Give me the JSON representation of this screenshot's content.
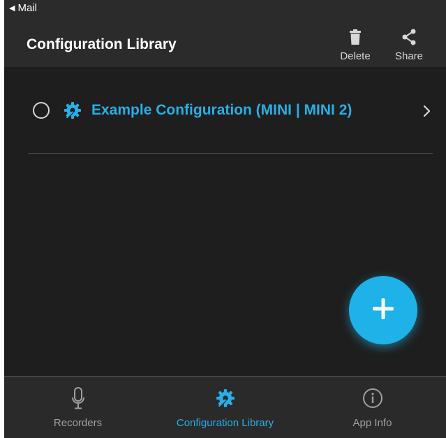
{
  "status_bar": {
    "back_label": "Mail"
  },
  "header": {
    "title": "Configuration Library",
    "actions": [
      {
        "label": "Delete",
        "icon": "trash-icon"
      },
      {
        "label": "Share",
        "icon": "share-icon"
      }
    ]
  },
  "library": {
    "items": [
      {
        "label": "Example Configuration (MINI | MINI 2)",
        "icon": "gear-wrench-icon",
        "selected": false
      }
    ]
  },
  "fab": {
    "icon": "plus-icon"
  },
  "tabs": [
    {
      "label": "Recorders",
      "icon": "microphone-icon",
      "active": false
    },
    {
      "label": "Configuration Library",
      "icon": "gear-wrench-icon",
      "active": true
    },
    {
      "label": "App Info",
      "icon": "info-icon",
      "active": false
    }
  ],
  "colors": {
    "accent": "#29aee6",
    "fab": "#1fb2e8",
    "background": "#1e1e1e",
    "header": "#2b2b2b"
  }
}
